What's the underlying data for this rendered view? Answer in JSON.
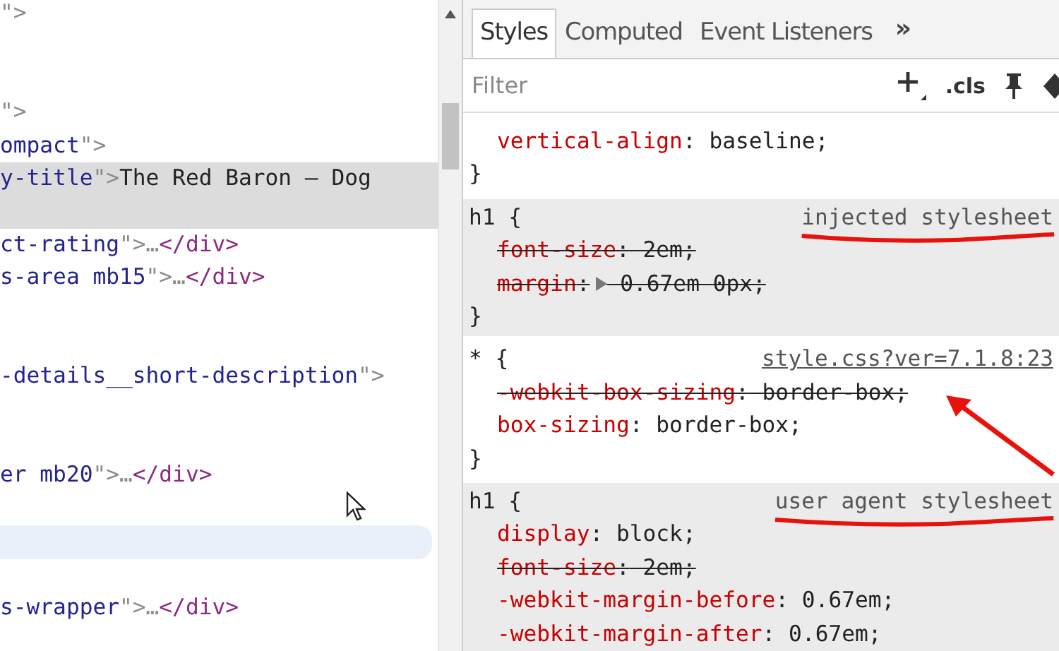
{
  "elements_panel": {
    "lines": [
      {
        "selected": false,
        "hovered": false,
        "segments": [
          {
            "kind": "punct",
            "text": "\">"
          }
        ]
      },
      {
        "selected": false,
        "hovered": false
      },
      {
        "selected": false,
        "hovered": false
      },
      {
        "selected": false,
        "hovered": false,
        "segments": [
          {
            "kind": "punct",
            "text": "\">"
          }
        ]
      },
      {
        "selected": false,
        "hovered": false,
        "segments": [
          {
            "kind": "value",
            "text": "ompact"
          },
          {
            "kind": "punct",
            "text": "\">"
          }
        ]
      },
      {
        "selected": true,
        "hovered": false,
        "segments": [
          {
            "kind": "value",
            "text": "y-title"
          },
          {
            "kind": "punct",
            "text": "\">"
          },
          {
            "kind": "text",
            "text": "The Red Baron – Dog"
          }
        ]
      },
      {
        "selected": true,
        "hovered": false
      },
      {
        "selected": false,
        "hovered": false,
        "segments": [
          {
            "kind": "value",
            "text": "ct-rating"
          },
          {
            "kind": "punct",
            "text": "\">…"
          },
          {
            "kind": "tag",
            "text": "</div>"
          }
        ]
      },
      {
        "selected": false,
        "hovered": false,
        "segments": [
          {
            "kind": "value",
            "text": "s-area mb15"
          },
          {
            "kind": "punct",
            "text": "\">…"
          },
          {
            "kind": "tag",
            "text": "</div>"
          }
        ]
      },
      {
        "selected": false,
        "hovered": false
      },
      {
        "selected": false,
        "hovered": false
      },
      {
        "selected": false,
        "hovered": false,
        "segments": [
          {
            "kind": "value",
            "text": "-details__short-description"
          },
          {
            "kind": "punct",
            "text": "\">"
          }
        ]
      },
      {
        "selected": false,
        "hovered": false
      },
      {
        "selected": false,
        "hovered": false
      },
      {
        "selected": false,
        "hovered": false,
        "segments": [
          {
            "kind": "value",
            "text": "er mb20"
          },
          {
            "kind": "punct",
            "text": "\">…"
          },
          {
            "kind": "tag",
            "text": "</div>"
          }
        ]
      },
      {
        "selected": false,
        "hovered": false
      },
      {
        "selected": false,
        "hovered": true
      },
      {
        "selected": false,
        "hovered": false
      },
      {
        "selected": false,
        "hovered": false,
        "segments": [
          {
            "kind": "value",
            "text": "s-wrapper"
          },
          {
            "kind": "punct",
            "text": "\">…"
          },
          {
            "kind": "tag",
            "text": "</div>"
          }
        ]
      },
      {
        "selected": false,
        "hovered": false
      }
    ]
  },
  "styles_panel": {
    "tabs": [
      {
        "label": "Styles",
        "selected": true
      },
      {
        "label": "Computed",
        "selected": false
      },
      {
        "label": "Event Listeners",
        "selected": false
      }
    ],
    "more_tabs": "»",
    "filter": {
      "placeholder": "Filter"
    },
    "toolbar": {
      "cls": ".cls"
    },
    "rules": [
      {
        "readonly": false,
        "close": "}",
        "declarations": [
          {
            "property": "vertical-align",
            "colon": ":",
            "value": "baseline;",
            "overridden": false,
            "expandable": false
          }
        ]
      },
      {
        "selector": "h1 {",
        "source": "injected stylesheet",
        "link": false,
        "readonly": true,
        "annotated": true,
        "close": "}",
        "declarations": [
          {
            "property": "font-size",
            "colon": ":",
            "value": "2em;",
            "overridden": true,
            "expandable": false
          },
          {
            "property": "margin",
            "colon": ":",
            "value": "0.67em 0px;",
            "overridden": true,
            "expandable": true
          }
        ]
      },
      {
        "selector": "* {",
        "source": "style.css?ver=7.1.8:23",
        "link": true,
        "readonly": false,
        "annotated": false,
        "close": "}",
        "declarations": [
          {
            "property": "-webkit-box-sizing",
            "colon": ":",
            "value": "border-box;",
            "overridden": true,
            "expandable": false
          },
          {
            "property": "box-sizing",
            "colon": ":",
            "value": "border-box;",
            "overridden": false,
            "expandable": false
          }
        ]
      },
      {
        "selector": "h1 {",
        "source": "user agent stylesheet",
        "link": false,
        "readonly": true,
        "annotated": true,
        "declarations": [
          {
            "property": "display",
            "colon": ":",
            "value": "block;",
            "overridden": false,
            "expandable": false
          },
          {
            "property": "font-size",
            "colon": ":",
            "value": "2em;",
            "overridden": true,
            "expandable": false
          },
          {
            "property": "-webkit-margin-before",
            "colon": ":",
            "value": "0.67em;",
            "overridden": false,
            "expandable": false
          },
          {
            "property": "-webkit-margin-after",
            "colon": ":",
            "value": "0.67em;",
            "overridden": false,
            "expandable": false
          }
        ]
      }
    ]
  }
}
